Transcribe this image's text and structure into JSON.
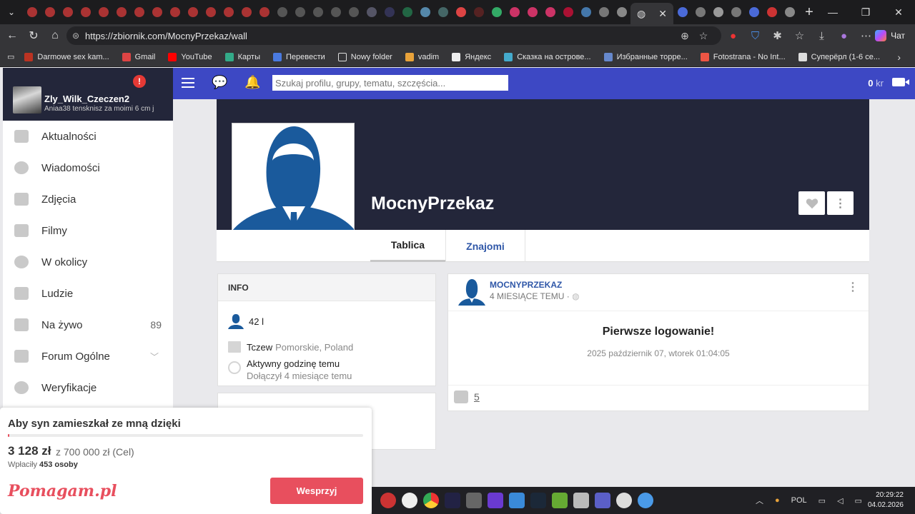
{
  "browser": {
    "url": "https://zbiornik.com/MocnyPrzekaz/wall",
    "chat_label": "Чат",
    "bookmarks": [
      "Darmowe sex kam...",
      "Gmail",
      "YouTube",
      "Карты",
      "Перевести",
      "Nowy folder",
      "vadim",
      "Яндекс",
      "Сказка на острове...",
      "Избранные торре...",
      "Fotostrana - No Int...",
      "Суперёрл (1-6 се..."
    ],
    "icons": {
      "back": "back-arrow-icon",
      "reload": "reload-icon",
      "home": "home-icon",
      "zoom": "zoom-icon",
      "star": "star-icon"
    }
  },
  "header": {
    "search_placeholder": "Szukaj profilu, grupy, tematu, szczęścia...",
    "credits_value": "0",
    "credits_unit": "kr"
  },
  "sidebar": {
    "user_name": "Zly_Wilk_Czeczen2",
    "user_status": "Aniaa38 tensknisz za moimi 6 cm j",
    "alert": "!",
    "items": [
      {
        "label": "Aktualności",
        "icon": "home-icon"
      },
      {
        "label": "Wiadomości",
        "icon": "chat-icon"
      },
      {
        "label": "Zdjęcia",
        "icon": "image-icon"
      },
      {
        "label": "Filmy",
        "icon": "film-icon"
      },
      {
        "label": "W okolicy",
        "icon": "location-icon"
      },
      {
        "label": "Ludzie",
        "icon": "people-icon"
      },
      {
        "label": "Na żywo",
        "icon": "video-icon",
        "count": "89"
      },
      {
        "label": "Forum Ogólne",
        "icon": "forum-icon"
      },
      {
        "label": "Weryfikacje",
        "icon": "check-circle-icon"
      }
    ]
  },
  "profile": {
    "name": "MocnyPrzekaz",
    "tabs": [
      "Tablica",
      "Znajomi"
    ],
    "info_title": "INFO",
    "age": "42 l",
    "city": "Tczew",
    "region": "Pomorskie, Poland",
    "active": "Aktywny godzinę temu",
    "joined": "Dołączył 4 miesiące temu"
  },
  "post": {
    "author": "MOCNYPRZEKAZ",
    "time": "4 MIESIĄCE TEMU ·",
    "title": "Pierwsze logowanie!",
    "date": "2025 październik 07, wtorek 01:04:05",
    "likes": "5"
  },
  "pomagam": {
    "title": "Aby syn zamieszkał ze mną dzięki",
    "amount": "3 128 zł",
    "goal": "z 700 000 zł (Cel)",
    "donors_label": "Wpłaciły",
    "donors": "453 osoby",
    "logo": "Pomagam.pl",
    "button": "Wesprzyj",
    "progress_fraction": 0.0045
  },
  "taskbar": {
    "lang": "POL",
    "time": "20:29:22",
    "date": "04.02.2026"
  },
  "colors": {
    "header_blue": "#3d48c4",
    "cover_dark": "#23263a",
    "link_blue": "#2f57a8",
    "pomagam_red": "#e84f5e"
  }
}
